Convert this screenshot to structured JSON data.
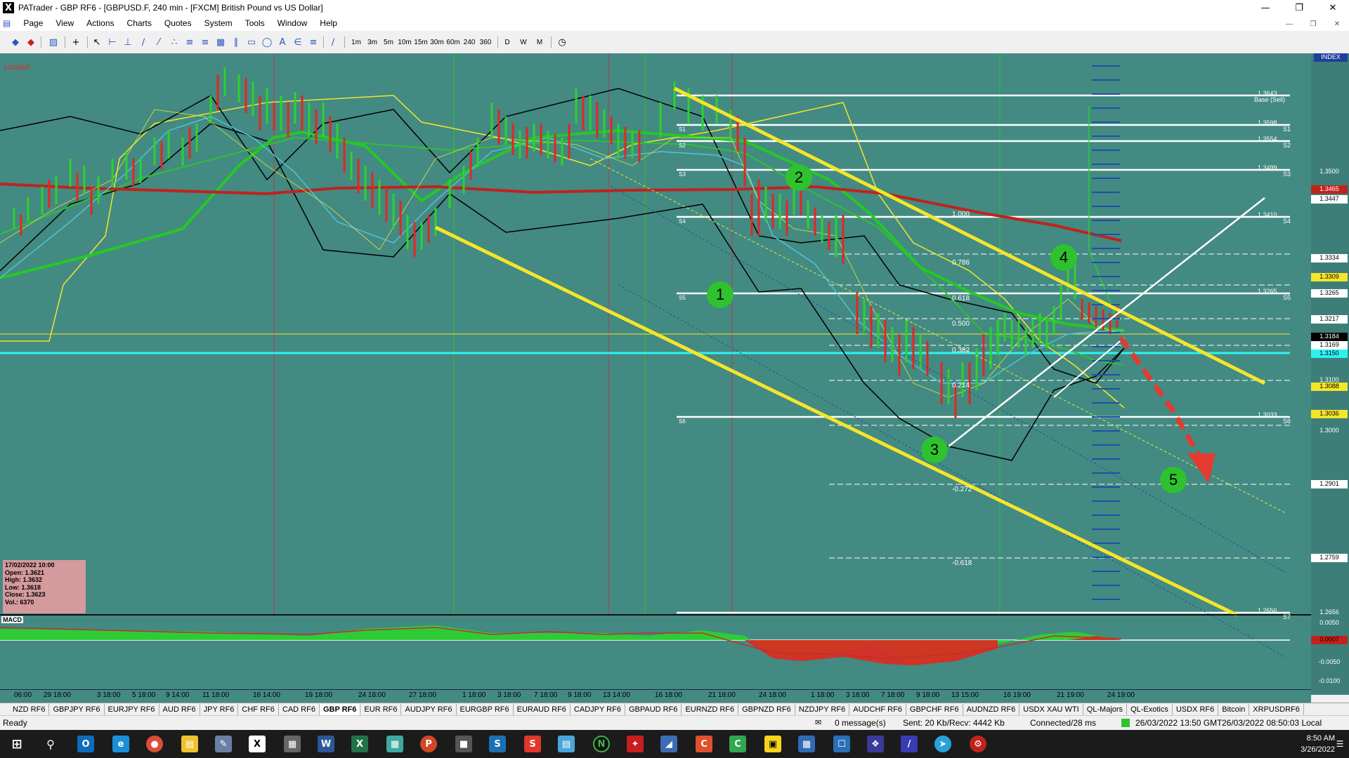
{
  "window": {
    "title": "PATrader - GBP RF6 - [GBPUSD.F, 240 min - [FXCM] British Pound vs US Dollar]",
    "app_icon": "X"
  },
  "menu": [
    "Page",
    "View",
    "Actions",
    "Charts",
    "Quotes",
    "System",
    "Tools",
    "Window",
    "Help"
  ],
  "toolbar": {
    "periods": [
      "1m",
      "3m",
      "5m",
      "10m",
      "15m",
      "30m",
      "60m",
      "240",
      "360",
      "D",
      "W",
      "M"
    ]
  },
  "chart": {
    "locked": "Locked",
    "index_label": "INDEX",
    "price_labels": [
      "1.3500",
      "1.3465",
      "1.3447",
      "1.3334",
      "1.3309",
      "1.3265",
      "1.3217",
      "1.3184",
      "1.3169",
      "1.3150",
      "1.3100",
      "1.3088",
      "1.3036",
      "1.3000",
      "1.2901",
      "1.2759",
      "1.2656"
    ],
    "levels": [
      {
        "price": "1.3643",
        "name": "Base (Sell)"
      },
      {
        "price": "1.3598",
        "name": "S1"
      },
      {
        "price": "1.3554",
        "name": "S2"
      },
      {
        "price": "1.3499",
        "name": "S3"
      },
      {
        "price": "1.3410",
        "name": "S4"
      },
      {
        "price": "1.3265",
        "name": "S5"
      },
      {
        "price": "1.3033",
        "name": "S6"
      },
      {
        "price": "1.2656",
        "name": "S7"
      }
    ],
    "left_level_tags": [
      "S1",
      "S2",
      "S3",
      "S4",
      "S5",
      "S6"
    ],
    "fib": [
      "1.000",
      "0.786",
      "0.618",
      "0.500",
      "0.382",
      "0.214",
      "-0.272",
      "-0.618"
    ],
    "waves": [
      "1",
      "2",
      "3",
      "4",
      "5"
    ],
    "ohlc": {
      "date": "17/02/2022 10:00",
      "open": "Open: 1.3621",
      "high": "High: 1.3632",
      "low": "Low: 1.3618",
      "close": "Close: 1.3623",
      "vol": "Vol.: 6370"
    },
    "macd_label": "MACD",
    "macd_scale": [
      "0.0050",
      "0.0007",
      "-0.0050",
      "-0.0100"
    ],
    "time_axis": [
      "06:00",
      "29 18:00",
      "3 18:00",
      "5 18:00",
      "9 14:00",
      "11 18:00",
      "16 14:00",
      "19 18:00",
      "24 18:00",
      "27 18:00",
      "1 18:00",
      "3 18:00",
      "7 18:00",
      "9 18:00",
      "13 14:00",
      "16 18:00",
      "21 18:00",
      "24 18:00",
      "1 18:00",
      "3 18:00",
      "7 18:00",
      "9 18:00",
      "13 15:00",
      "16 19:00",
      "21 19:00",
      "24 19:00"
    ]
  },
  "tabs": [
    "NZD RF6",
    "GBPJPY RF6",
    "EURJPY RF6",
    "AUD RF6",
    "JPY RF6",
    "CHF RF6",
    "CAD RF6",
    "GBP RF6",
    "EUR RF6",
    "AUDJPY RF6",
    "EURGBP RF6",
    "EURAUD RF6",
    "CADJPY RF6",
    "GBPAUD RF6",
    "EURNZD RF6",
    "GBPNZD RF6",
    "NZDJPY RF6",
    "AUDCHF RF6",
    "GBPCHF RF6",
    "AUDNZD RF6",
    "USDX XAU WTI",
    "QL-Majors",
    "QL-Exotics",
    "USDX RF6",
    "Bitcoin",
    "XRPUSDRF6"
  ],
  "active_tab": "GBP RF6",
  "status": {
    "ready": "Ready",
    "messages": "0 message(s)",
    "traffic": "Sent: 20 Kb/Recv: 4442 Kb",
    "connection": "Connected/28 ms",
    "gmt": "26/03/2022 13:50 GMT",
    "local": "26/03/2022 08:50:03 Local"
  },
  "taskbar": {
    "time": "8:50 AM",
    "date": "3/26/2022"
  },
  "colors": {
    "chart_bg": "#438a82",
    "channel": "#f5e52a",
    "ma_red": "#c0231c",
    "ma_green": "#2ed12e",
    "level": "#ffffff",
    "cyan": "#2ef2f2",
    "wave": "#2ec22e"
  }
}
